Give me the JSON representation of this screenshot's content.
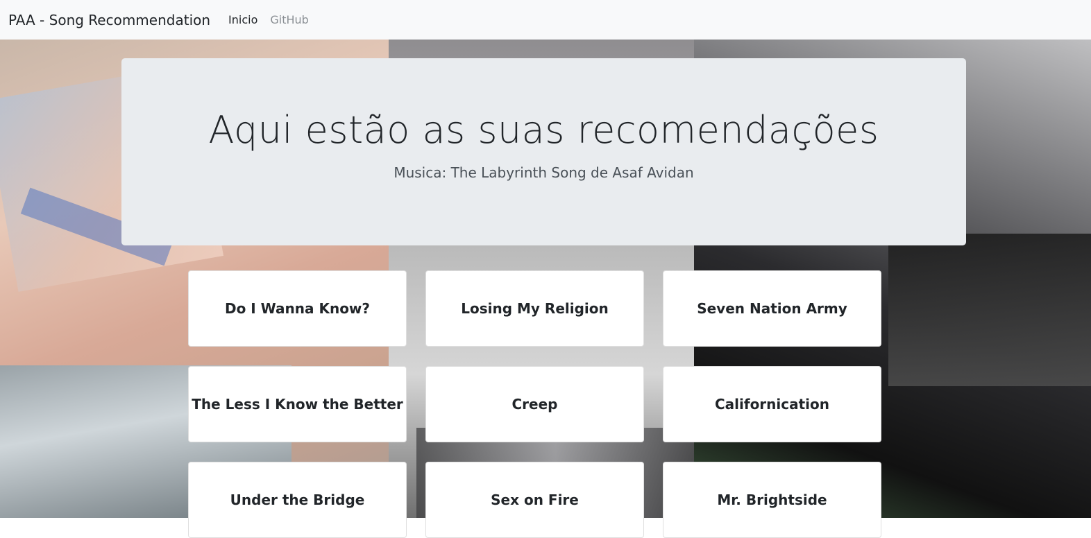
{
  "navbar": {
    "brand": "PAA - Song Recommendation",
    "links": [
      {
        "label": "Inicio",
        "active": true
      },
      {
        "label": "GitHub",
        "active": false
      }
    ]
  },
  "jumbotron": {
    "title": "Aqui estão as suas recomendações",
    "subtitle": "Musica: The Labyrinth Song de Asaf Avidan"
  },
  "recommendations": [
    "Do I Wanna Know?",
    "Losing My Religion",
    "Seven Nation Army",
    "The Less I Know the Better",
    "Creep",
    "Californication",
    "Under the Bridge",
    "Sex on Fire",
    "Mr. Brightside"
  ],
  "colors": {
    "navbar_bg": "#f8f9fa",
    "jumbotron_bg": "#e9ecef",
    "card_bg": "#ffffff",
    "text": "#212529",
    "muted_link": "#8a8f94"
  }
}
